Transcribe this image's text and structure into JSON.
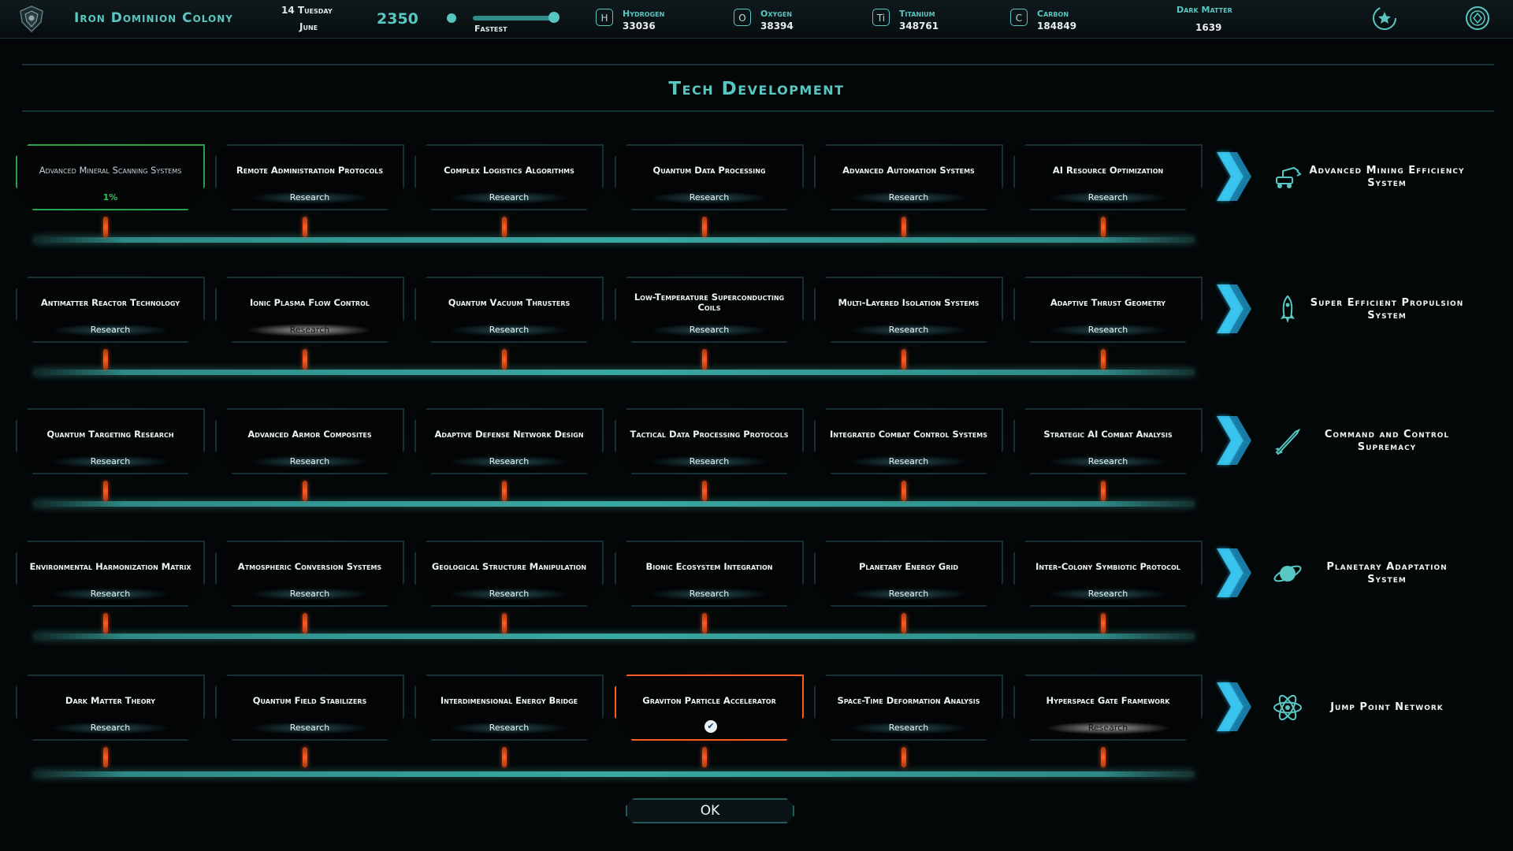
{
  "topbar": {
    "colony_name": "Iron Dominion Colony",
    "date_day": "14 Tuesday",
    "date_month": "June",
    "year": "2350",
    "speed_label": "Fastest",
    "resources": [
      {
        "symbol": "H",
        "name": "Hydrogen",
        "value": "33036"
      },
      {
        "symbol": "O",
        "name": "Oxygen",
        "value": "38394"
      },
      {
        "symbol": "Ti",
        "name": "Titanium",
        "value": "348761"
      },
      {
        "symbol": "C",
        "name": "Carbon",
        "value": "184849"
      }
    ],
    "dark_matter": {
      "name": "Dark Matter",
      "value": "1639"
    }
  },
  "title": "Tech Development",
  "rows": [
    {
      "outcome": "Advanced Mining Efficiency System",
      "outcome_icon": "mining-rover-icon",
      "cards": [
        {
          "title": "Advanced Mineral Scanning Systems",
          "status": "1%"
        },
        {
          "title": "Remote Administration Protocols",
          "status": "Research"
        },
        {
          "title": "Complex Logistics Algorithms",
          "status": "Research"
        },
        {
          "title": "Quantum Data Processing",
          "status": "Research"
        },
        {
          "title": "Advanced Automation Systems",
          "status": "Research"
        },
        {
          "title": "AI Resource Optimization",
          "status": "Research"
        }
      ]
    },
    {
      "outcome": "Super Efficient Propulsion System",
      "outcome_icon": "rocket-icon",
      "cards": [
        {
          "title": "Antimatter Reactor Technology",
          "status": "Research"
        },
        {
          "title": "Ionic Plasma Flow Control",
          "status": "Research"
        },
        {
          "title": "Quantum Vacuum Thrusters",
          "status": "Research"
        },
        {
          "title": "Low-Temperature Superconducting Coils",
          "status": "Research"
        },
        {
          "title": "Multi-Layered Isolation Systems",
          "status": "Research"
        },
        {
          "title": "Adaptive Thrust Geometry",
          "status": "Research"
        }
      ]
    },
    {
      "outcome": "Command and Control Supremacy",
      "outcome_icon": "missile-icon",
      "cards": [
        {
          "title": "Quantum Targeting Research",
          "status": "Research"
        },
        {
          "title": "Advanced Armor Composites",
          "status": "Research"
        },
        {
          "title": "Adaptive Defense Network Design",
          "status": "Research"
        },
        {
          "title": "Tactical Data Processing Protocols",
          "status": "Research"
        },
        {
          "title": "Integrated Combat Control Systems",
          "status": "Research"
        },
        {
          "title": "Strategic AI Combat Analysis",
          "status": "Research"
        }
      ]
    },
    {
      "outcome": "Planetary Adaptation System",
      "outcome_icon": "planet-icon",
      "cards": [
        {
          "title": "Environmental Harmonization Matrix",
          "status": "Research"
        },
        {
          "title": "Atmospheric Conversion Systems",
          "status": "Research"
        },
        {
          "title": "Geological Structure Manipulation",
          "status": "Research"
        },
        {
          "title": "Bionic Ecosystem Integration",
          "status": "Research"
        },
        {
          "title": "Planetary Energy Grid",
          "status": "Research"
        },
        {
          "title": "Inter-Colony Symbiotic Protocol",
          "status": "Research"
        }
      ]
    },
    {
      "outcome": "Jump Point Network",
      "outcome_icon": "atom-icon",
      "cards": [
        {
          "title": "Dark Matter Theory",
          "status": "Research"
        },
        {
          "title": "Quantum Field Stabilizers",
          "status": "Research"
        },
        {
          "title": "Interdimensional Energy Bridge",
          "status": "Research"
        },
        {
          "title": "Graviton Particle Accelerator",
          "status": ""
        },
        {
          "title": "Space-Time Deformation Analysis",
          "status": "Research"
        },
        {
          "title": "Hyperspace Gate Framework",
          "status": "Research"
        }
      ]
    }
  ],
  "ok_label": "OK",
  "colors": {
    "accent": "#58c7c2",
    "in_progress": "#2aa14a",
    "selected": "#ff5a1f",
    "connector": "#ff5a1f"
  }
}
